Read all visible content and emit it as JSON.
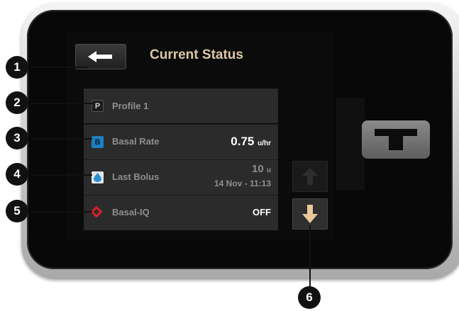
{
  "header": {
    "title": "Current Status",
    "back_icon": "arrow-left-icon"
  },
  "status_rows": [
    {
      "icon_letter": "P",
      "icon_color": "#1f1f1f",
      "label": "Profile 1"
    },
    {
      "icon_letter": "B",
      "icon_color": "#1e7fc1",
      "label": "Basal Rate",
      "value": "0.75",
      "unit": "u/hr"
    },
    {
      "icon": "drop-icon",
      "icon_color": "#2c8fd6",
      "label": "Last Bolus",
      "value": "10",
      "unit": "u",
      "sub": "14 Nov - 11:13"
    },
    {
      "icon": "basal-iq-diamond-icon",
      "icon_color": "#d52029",
      "label": "Basal-IQ",
      "value": "OFF"
    }
  ],
  "scroll": {
    "up_state": "disabled",
    "down_state": "enabled",
    "accent": "#e8c99a"
  },
  "callouts": [
    "1",
    "2",
    "3",
    "4",
    "5",
    "6"
  ]
}
